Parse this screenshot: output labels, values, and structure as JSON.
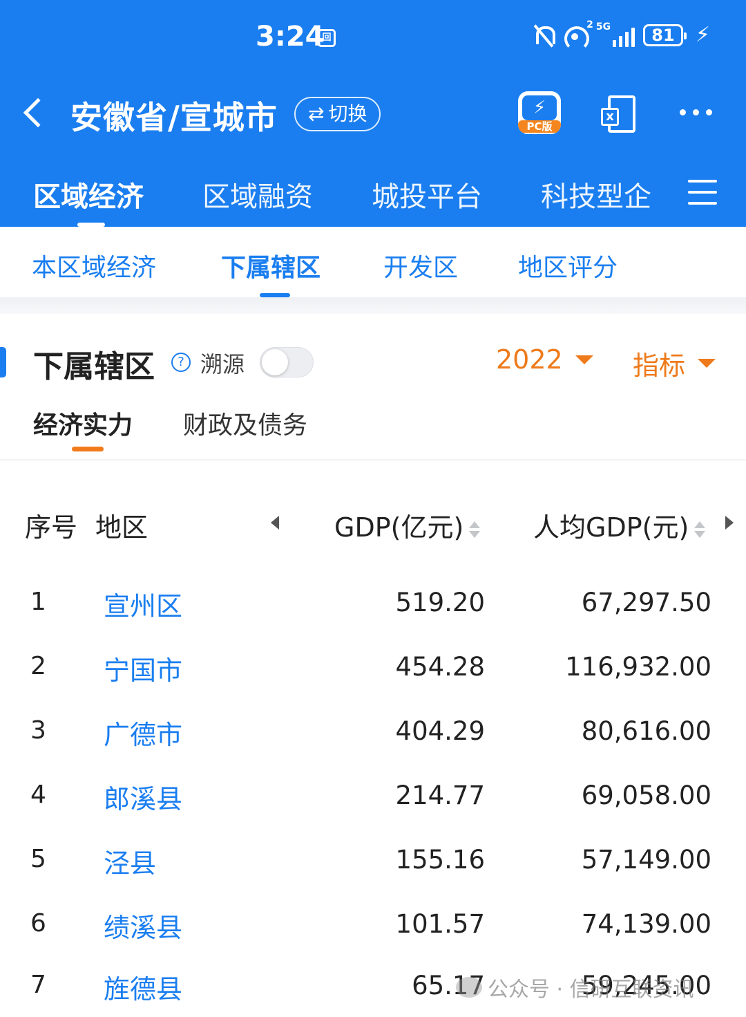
{
  "status_bar": {
    "time": "3:24",
    "app_icon_glyph": "回",
    "hotspot_count": "2",
    "network": "5G",
    "battery": "81"
  },
  "titlebar": {
    "title": "安徽省/宣城市",
    "switch_label": "切换",
    "switch_icon": "⇄",
    "pc_label": "PC版"
  },
  "main_tabs": [
    "区域经济",
    "区域融资",
    "城投平台",
    "科技型企"
  ],
  "sub_tabs": [
    "本区域经济",
    "下属辖区",
    "开发区",
    "地区评分"
  ],
  "section": {
    "title": "下属辖区",
    "help_glyph": "?",
    "trace_label": "溯源",
    "year": "2022",
    "metric": "指标"
  },
  "category_tabs": [
    "经济实力",
    "财政及债务"
  ],
  "table": {
    "headers": {
      "index": "序号",
      "region": "地区",
      "gdp": "GDP(亿元)",
      "per_capita_gdp": "人均GDP(元)"
    },
    "rows": [
      {
        "index": "1",
        "region": "宣州区",
        "gdp": "519.20",
        "per_capita_gdp": "67,297.50"
      },
      {
        "index": "2",
        "region": "宁国市",
        "gdp": "454.28",
        "per_capita_gdp": "116,932.00"
      },
      {
        "index": "3",
        "region": "广德市",
        "gdp": "404.29",
        "per_capita_gdp": "80,616.00"
      },
      {
        "index": "4",
        "region": "郎溪县",
        "gdp": "214.77",
        "per_capita_gdp": "69,058.00"
      },
      {
        "index": "5",
        "region": "泾县",
        "gdp": "155.16",
        "per_capita_gdp": "57,149.00"
      },
      {
        "index": "6",
        "region": "绩溪县",
        "gdp": "101.57",
        "per_capita_gdp": "74,139.00"
      },
      {
        "index": "7",
        "region": "旌德县",
        "gdp": "65.17",
        "per_capita_gdp": "59,245.00"
      }
    ]
  },
  "watermark": "公众号 · 信研互联资讯",
  "colors": {
    "primary": "#1a7ef0",
    "accent": "#ee7a1b"
  }
}
